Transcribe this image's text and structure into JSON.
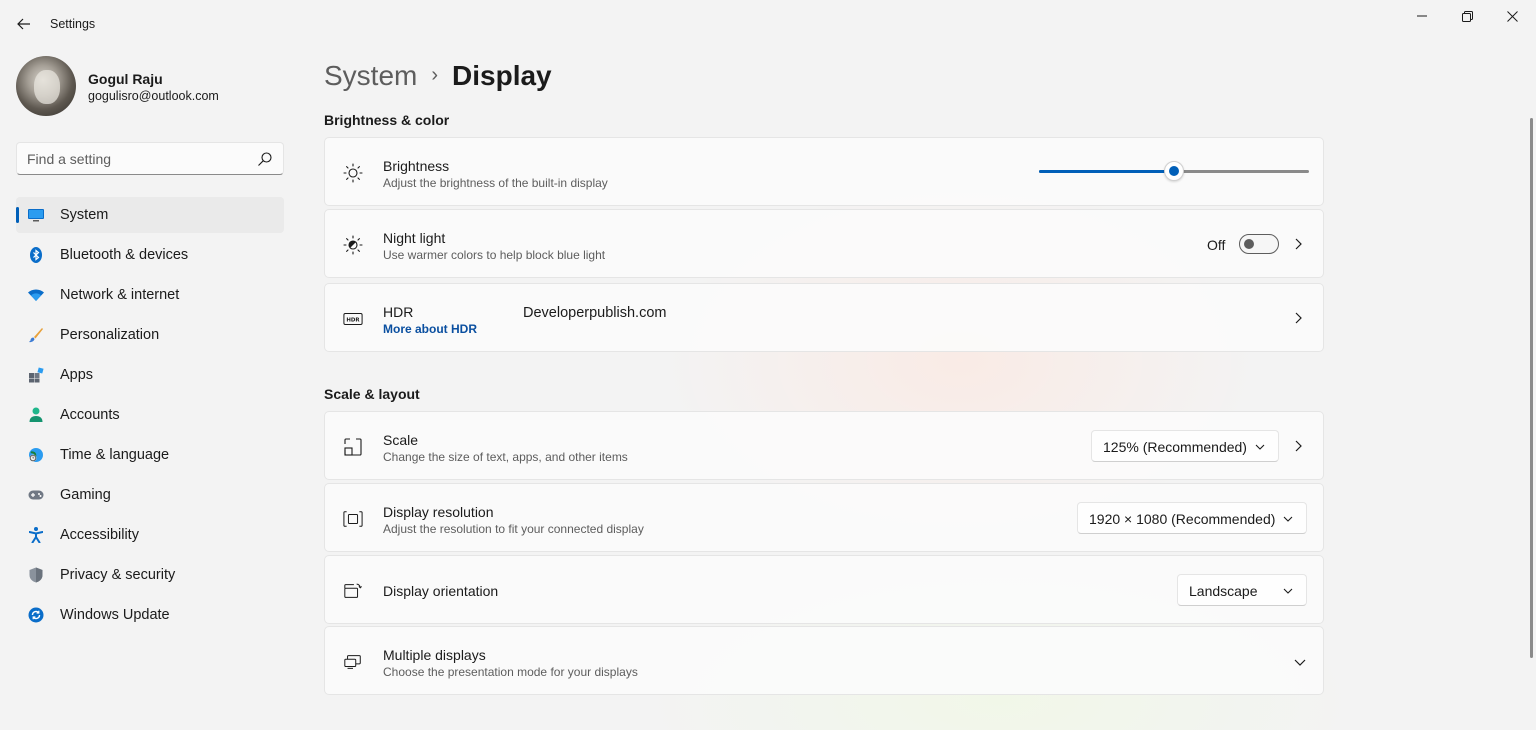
{
  "window": {
    "title": "Settings",
    "controls": {
      "minimize": "minimize-icon",
      "maximize": "restore-icon",
      "close": "close-icon"
    }
  },
  "user": {
    "name": "Gogul Raju",
    "email": "gogulisro@outlook.com"
  },
  "search": {
    "placeholder": "Find a setting",
    "value": ""
  },
  "sidebar": {
    "items": [
      {
        "label": "System",
        "icon": "monitor-icon",
        "active": true
      },
      {
        "label": "Bluetooth & devices",
        "icon": "bluetooth-icon"
      },
      {
        "label": "Network & internet",
        "icon": "wifi-icon"
      },
      {
        "label": "Personalization",
        "icon": "brush-icon"
      },
      {
        "label": "Apps",
        "icon": "apps-icon"
      },
      {
        "label": "Accounts",
        "icon": "person-icon"
      },
      {
        "label": "Time & language",
        "icon": "globe-clock-icon"
      },
      {
        "label": "Gaming",
        "icon": "gamepad-icon"
      },
      {
        "label": "Accessibility",
        "icon": "accessibility-icon"
      },
      {
        "label": "Privacy & security",
        "icon": "shield-icon"
      },
      {
        "label": "Windows Update",
        "icon": "update-icon"
      }
    ]
  },
  "breadcrumb": {
    "parent": "System",
    "separator": "›",
    "current": "Display"
  },
  "brightness_color": {
    "heading": "Brightness & color",
    "brightness": {
      "title": "Brightness",
      "description": "Adjust the brightness of the built-in display",
      "level_percent": 50
    },
    "night_light": {
      "title": "Night light",
      "description": "Use warmer colors to help block blue light",
      "state": "Off",
      "on": false
    },
    "hdr": {
      "title": "HDR",
      "link": "More about HDR"
    }
  },
  "watermark": "Developerpublish.com",
  "scale_layout": {
    "heading": "Scale & layout",
    "scale": {
      "title": "Scale",
      "description": "Change the size of text, apps, and other items",
      "selected": "125% (Recommended)"
    },
    "resolution": {
      "title": "Display resolution",
      "description": "Adjust the resolution to fit your connected display",
      "selected": "1920 × 1080 (Recommended)"
    },
    "orientation": {
      "title": "Display orientation",
      "selected": "Landscape"
    },
    "multiple": {
      "title": "Multiple displays",
      "description": "Choose the presentation mode for your displays"
    }
  },
  "colors": {
    "accent": "#005fb8",
    "link": "#0a4fa0",
    "background": "#f3f3f3",
    "card": "#fbfbfb"
  }
}
